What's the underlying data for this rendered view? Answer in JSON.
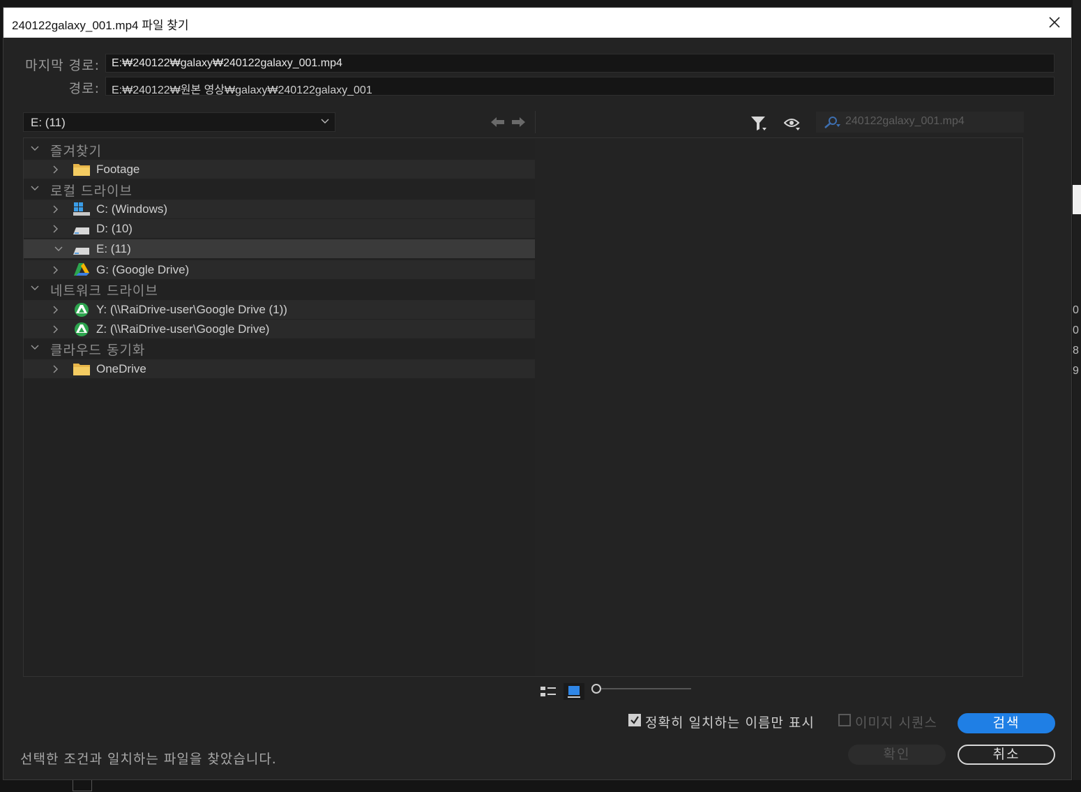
{
  "dialog": {
    "title": "240122galaxy_001.mp4 파일 찾기"
  },
  "fields": {
    "last_path_label": "마지막 경로:",
    "last_path_value": "E:₩240122₩galaxy₩240122galaxy_001.mp4",
    "path_label": "경로:",
    "path_value": "E:₩240122₩원본 영상₩galaxy₩240122galaxy_001"
  },
  "drive_select": {
    "value": "E: (11)"
  },
  "search": {
    "placeholder": "240122galaxy_001.mp4"
  },
  "tree": {
    "favorites": {
      "label": "즐겨찾기",
      "items": [
        {
          "label": "Footage",
          "icon": "folder-icon"
        }
      ]
    },
    "local": {
      "label": "로컬 드라이브",
      "items": [
        {
          "label": "C: (Windows)",
          "icon": "windows-drive-icon"
        },
        {
          "label": "D: (10)",
          "icon": "drive-icon"
        },
        {
          "label": "E: (11)",
          "icon": "drive-icon",
          "selected": true,
          "expanded": true
        },
        {
          "label": "G: (Google Drive)",
          "icon": "google-drive-icon"
        }
      ]
    },
    "network": {
      "label": "네트워크 드라이브",
      "items": [
        {
          "label": "Y: (\\\\RaiDrive-user\\Google Drive (1))",
          "icon": "network-google-drive-icon"
        },
        {
          "label": "Z: (\\\\RaiDrive-user\\Google Drive)",
          "icon": "network-google-drive-icon"
        }
      ]
    },
    "cloud": {
      "label": "클라우드 동기화",
      "items": [
        {
          "label": "OneDrive",
          "icon": "folder-icon"
        }
      ]
    }
  },
  "options": {
    "exact_match_label": "정확히 일치하는 이름만 표시",
    "exact_match_checked": true,
    "image_sequence_label": "이미지 시퀀스",
    "image_sequence_checked": false
  },
  "buttons": {
    "search": "검색",
    "ok": "확인",
    "cancel": "취소"
  },
  "status_text": "선택한 조건과 일치하는 파일을 찾았습니다.",
  "background": {
    "side_digits": [
      "0",
      "0",
      "8",
      "9"
    ]
  },
  "colors": {
    "accent": "#1f7fe5",
    "dialog_bg": "#232323",
    "row_bg": "#2a2a2a",
    "row_selected": "#3a3a3a"
  }
}
